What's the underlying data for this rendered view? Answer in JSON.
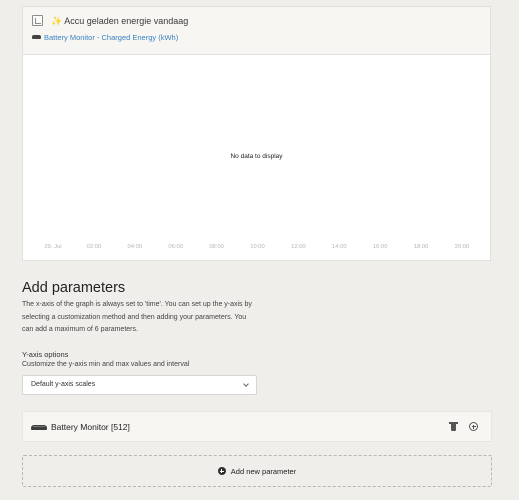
{
  "chart": {
    "title_icon": "sparkles",
    "title": "Accu geladen energie vandaag",
    "series_icon": "battery-monitor-device",
    "series_label": "Battery Monitor - Charged Energy (kWh)",
    "empty_message": "No data to display",
    "x_tick_labels": [
      "29. Jul",
      "02:00",
      "04:00",
      "06:00",
      "08:00",
      "10:00",
      "12:00",
      "14:00",
      "16:00",
      "18:00",
      "20:00"
    ]
  },
  "params_section": {
    "title": "Add parameters",
    "description": "The x-axis of the graph is always set to 'time'. You can set up the y-axis by selecting a customization method and then adding your parameters. You can add a maximum of 6 parameters.",
    "yaxis_label": "Y-axis options",
    "yaxis_help": "Customize the y-axis min and max values and interval",
    "yaxis_select_value": "Default y-axis scales"
  },
  "parameters": [
    {
      "label": "Battery Monitor [512]",
      "icon": "battery-monitor-device"
    }
  ],
  "add_parameter_label": "Add new parameter",
  "colors": {
    "background": "#efeeeb",
    "link_blue": "#3b82c4",
    "sparkle": "#e8b21a"
  }
}
